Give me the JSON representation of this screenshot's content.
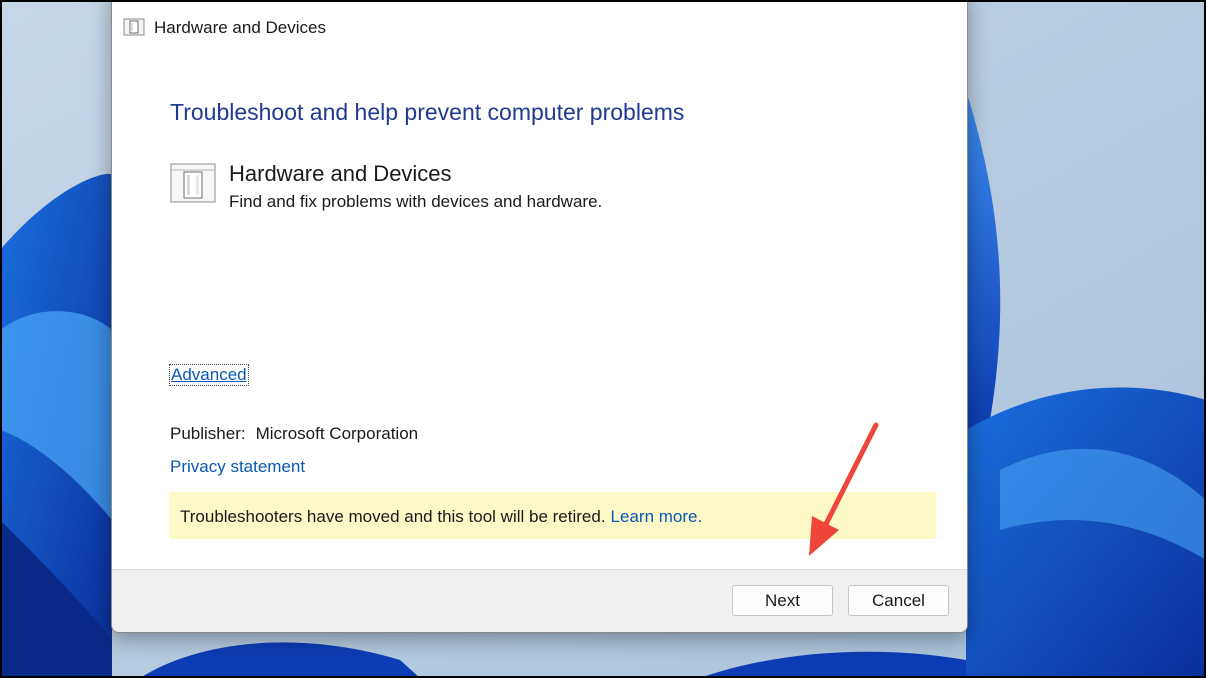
{
  "window": {
    "title": "Hardware and Devices",
    "icon": "troubleshooter-device-icon"
  },
  "content": {
    "heading": "Troubleshoot and help prevent computer problems",
    "tool": {
      "name": "Hardware and Devices",
      "description": "Find and fix problems with devices and hardware.",
      "icon": "hardware-device-icon"
    },
    "advanced_link": "Advanced",
    "publisher_label": "Publisher:",
    "publisher_value": "Microsoft Corporation",
    "privacy_link": "Privacy statement",
    "notice": {
      "text": "Troubleshooters have moved and this tool will be retired.",
      "link": "Learn more."
    }
  },
  "footer": {
    "next_label": "Next",
    "cancel_label": "Cancel"
  },
  "annotation": {
    "arrow_icon": "red-arrow-icon",
    "arrow_color": "#f0463a"
  },
  "colors": {
    "heading": "#1f3a93",
    "link": "#0a58b8",
    "notice_bg": "#fcf9c6",
    "footer_bg": "#f0f0f0"
  }
}
